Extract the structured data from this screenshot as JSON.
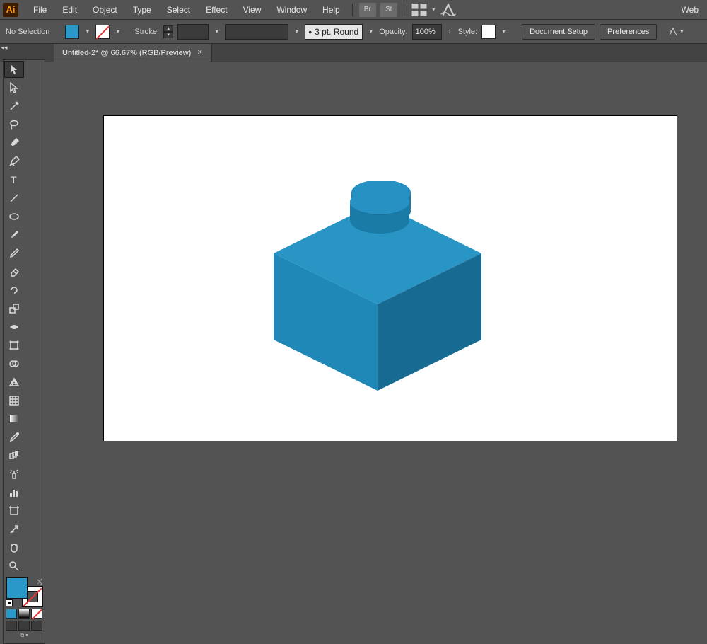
{
  "menu": {
    "items": [
      "File",
      "Edit",
      "Object",
      "Type",
      "Select",
      "Effect",
      "View",
      "Window",
      "Help"
    ],
    "right_label": "Web"
  },
  "control": {
    "selection_info": "No Selection",
    "stroke_label": "Stroke:",
    "brush_profile": "3 pt. Round",
    "opacity_label": "Opacity:",
    "opacity_value": "100%",
    "style_label": "Style:",
    "buttons": {
      "doc_setup": "Document Setup",
      "prefs": "Preferences"
    }
  },
  "tab": {
    "title": "Untitled-2* @ 66.67% (RGB/Preview)"
  },
  "colors": {
    "fill": "#2b99c8",
    "stroke": "none"
  },
  "toolbox": {
    "tools": [
      [
        "selection",
        "direct-selection"
      ],
      [
        "magic-wand",
        "lasso"
      ],
      [
        "pen",
        "curvature"
      ],
      [
        "type",
        "line-segment"
      ],
      [
        "ellipse",
        "paintbrush"
      ],
      [
        "pencil",
        "eraser"
      ],
      [
        "rotate",
        "scale"
      ],
      [
        "width",
        "free-transform"
      ],
      [
        "shape-builder",
        "perspective-grid"
      ],
      [
        "mesh",
        "gradient"
      ],
      [
        "eyedropper",
        "blend"
      ],
      [
        "symbol-sprayer",
        "column-graph"
      ],
      [
        "artboard",
        "slice"
      ],
      [
        "hand",
        "zoom"
      ]
    ]
  }
}
